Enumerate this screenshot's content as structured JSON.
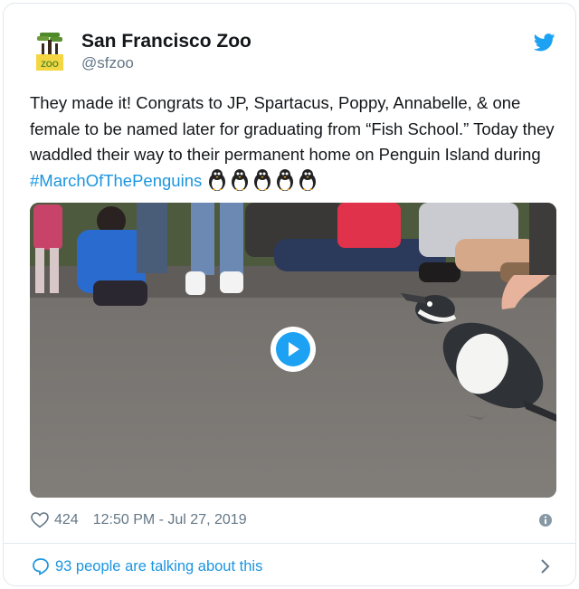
{
  "account": {
    "name": "San Francisco Zoo",
    "handle": "@sfzoo",
    "logo_text": "ZOO"
  },
  "tweet": {
    "text_before": "They made it! Congrats to JP, Spartacus, Poppy, Annabelle, & one female to be named later for graduating from “Fish School.” Today they waddled their way to their permanent home on Penguin Island during ",
    "hashtag": "#MarchOfThePenguins",
    "emoji": [
      "penguin-emoji",
      "penguin-emoji",
      "penguin-emoji",
      "penguin-emoji",
      "penguin-emoji"
    ]
  },
  "media": {
    "type": "video",
    "play_icon": "play-icon"
  },
  "meta": {
    "likes": "424",
    "timestamp": "12:50 PM - Jul 27, 2019"
  },
  "footer": {
    "talking_label": "93 people are talking about this"
  },
  "colors": {
    "twitter_blue": "#1da1f2",
    "link_blue": "#1b95e0",
    "secondary_text": "#657786",
    "border": "#e1e8ed",
    "logo_green": "#6a9a3a"
  }
}
